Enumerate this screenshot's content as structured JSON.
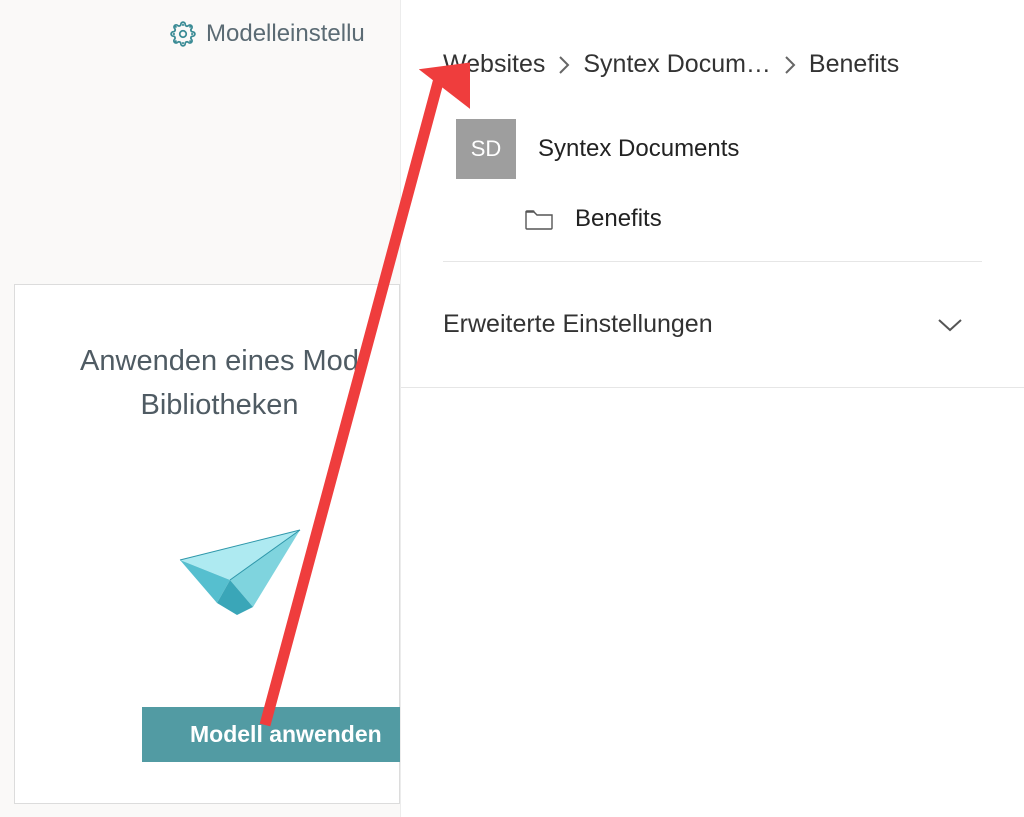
{
  "main": {
    "settings_link_label": "Modelleinstellu",
    "card_heading_line1": "Anwenden eines Mod",
    "card_heading_line2": "Bibliotheken",
    "apply_button_label": "Modell anwenden"
  },
  "panel": {
    "breadcrumb": {
      "crumb1": "Websites",
      "crumb2": "Syntex Docum…",
      "crumb3": "Benefits"
    },
    "site": {
      "badge": "SD",
      "name": "Syntex Documents"
    },
    "library": {
      "name": "Benefits"
    },
    "accordion_label": "Erweiterte Einstellungen"
  },
  "colors": {
    "teal": "#529ba3",
    "plane_fill": "#6fc9d6",
    "plane_dark": "#3aa6b8",
    "arrow_red": "#ef3d3d"
  }
}
